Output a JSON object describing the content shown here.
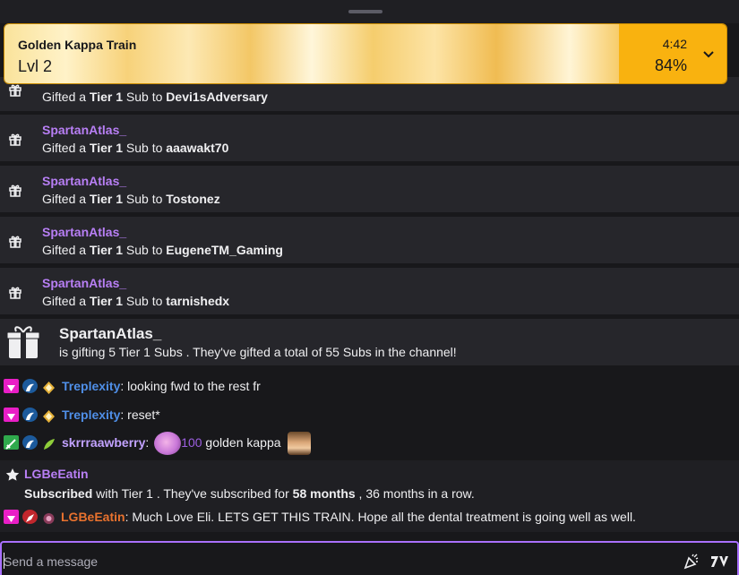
{
  "hype_train": {
    "title": "Golden Kappa Train",
    "level": "Lvl 2",
    "timer": "4:42",
    "percent": "84%",
    "progress": 0.84
  },
  "gifts": [
    {
      "name": "",
      "prefix": "Gifted a ",
      "tier": "Tier 1",
      "mid": " Sub to ",
      "recipient": "Devi1sAdversary"
    },
    {
      "name": "SpartanAtlas_",
      "prefix": "Gifted a ",
      "tier": "Tier 1",
      "mid": " Sub to ",
      "recipient": "aaawakt70"
    },
    {
      "name": "SpartanAtlas_",
      "prefix": "Gifted a ",
      "tier": "Tier 1",
      "mid": " Sub to ",
      "recipient": "Tostonez"
    },
    {
      "name": "SpartanAtlas_",
      "prefix": "Gifted a ",
      "tier": "Tier 1",
      "mid": " Sub to ",
      "recipient": "EugeneTM_Gaming"
    },
    {
      "name": "SpartanAtlas_",
      "prefix": "Gifted a ",
      "tier": "Tier 1",
      "mid": " Sub to ",
      "recipient": "tarnishedx"
    }
  ],
  "mystery_gift": {
    "name": "SpartanAtlas_",
    "text": "is gifting 5 Tier 1 Subs . They've gifted a total of 55 Subs in the channel!"
  },
  "messages": [
    {
      "user": "Treplexity",
      "user_color": "#4f8fe8",
      "text": ": looking fwd to the rest fr"
    },
    {
      "user": "Treplexity",
      "user_color": "#4f8fe8",
      "text": ": reset*"
    },
    {
      "user": "skrrraawberry",
      "user_color": "#c2a2ff",
      "text": ":",
      "cheer": "100",
      "after": " golden kappa"
    }
  ],
  "resub": {
    "name": "LGBeEatin",
    "subscribed": "Subscribed",
    "text_a": " with Tier 1 . They've subscribed for ",
    "months": "58 months",
    "text_b": " , 36 months in a row.",
    "user": "LGBeEatin",
    "user_color": "#e8722e",
    "message": ": Much Love Eli. LETS GET THIS TRAIN. Hope all the dental treatment is going well as well."
  },
  "chat_input": {
    "placeholder": "Send a message"
  },
  "colors": {
    "accent": "#a970ff",
    "hype_gold": "#f9b20f",
    "gifter": "#b87ff5"
  }
}
